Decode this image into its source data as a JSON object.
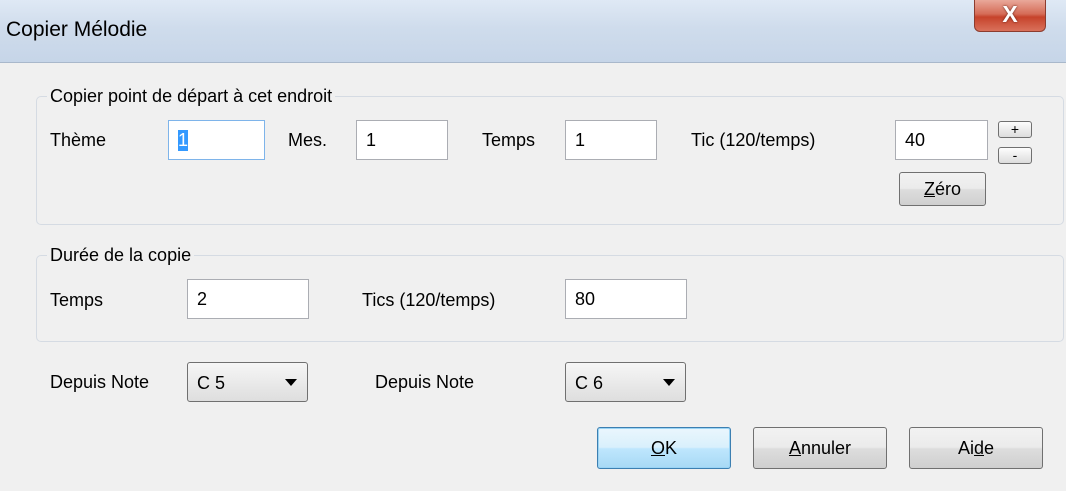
{
  "window": {
    "title": "Copier Mélodie",
    "close_glyph": "X"
  },
  "start_group": {
    "label": "Copier point de départ à cet endroit",
    "theme_label": "Thème",
    "theme_value": "1",
    "mes_label": "Mes.",
    "mes_value": "1",
    "temps_label": "Temps",
    "temps_value": "1",
    "tic_label": "Tic (120/temps)",
    "tic_value": "40",
    "plus_label": "+",
    "minus_label": "-",
    "zero_prefix": "Z",
    "zero_rest": "éro"
  },
  "duration_group": {
    "label": "Durée de la copie",
    "temps_label": "Temps",
    "temps_value": "2",
    "tics_label": "Tics (120/temps)",
    "tics_value": "80"
  },
  "notes": {
    "from_label_1": "Depuis Note",
    "from_value_1": "C 5",
    "from_label_2": "Depuis Note",
    "from_value_2": "C 6"
  },
  "buttons": {
    "ok_prefix": "O",
    "ok_rest": "K",
    "cancel_prefix": "A",
    "cancel_rest": "nnuler",
    "help_pre": "Ai",
    "help_u": "d",
    "help_post": "e"
  },
  "colors": {
    "dialog_bg": "#f0f0f0",
    "close_button": "#c6432b",
    "default_button_border": "#3c7fb1",
    "focus_border": "#7eb4ea"
  },
  "icons": {
    "close": "close-icon",
    "dropdown": "chevron-down-icon"
  }
}
